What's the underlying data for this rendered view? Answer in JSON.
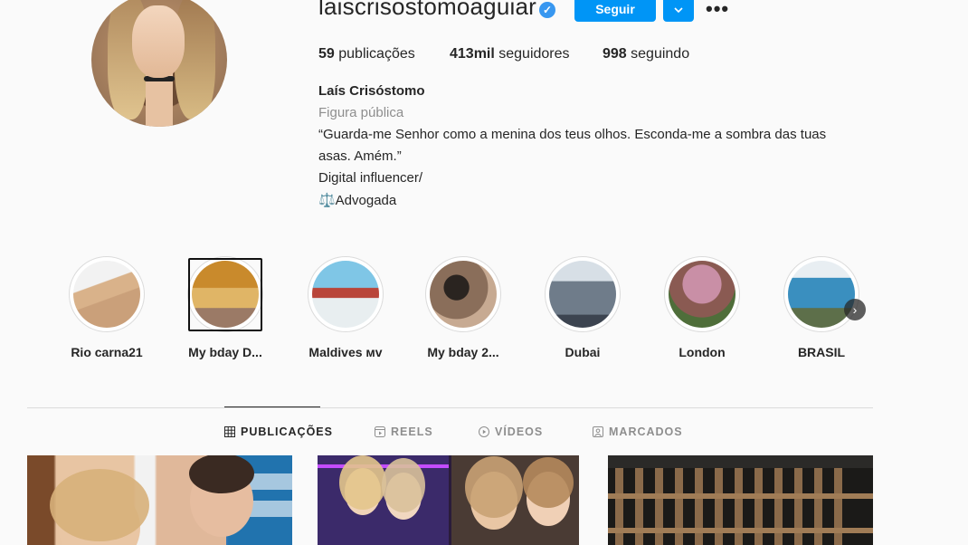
{
  "profile": {
    "username": "laiscrisostomoaguiar",
    "follow_label": "Seguir",
    "stats": {
      "posts_count": "59",
      "posts_label": " publicações",
      "followers_count": "413mil",
      "followers_label": " seguidores",
      "following_count": "998",
      "following_label": " seguindo"
    },
    "full_name": "Laís Crisóstomo",
    "category": "Figura pública",
    "bio_lines": [
      "“Guarda-me Senhor como a menina dos teus olhos. Esconda-me a sombra das tuas",
      "asas. Amém.”",
      "Digital influencer/",
      "⚖️Advogada"
    ]
  },
  "highlights": [
    {
      "label": "Rio carna21"
    },
    {
      "label": "My bday D..."
    },
    {
      "label": "Maldives ᴍᴠ"
    },
    {
      "label": "My bday 2..."
    },
    {
      "label": "Dubai"
    },
    {
      "label": "London"
    },
    {
      "label": "BRASIL"
    }
  ],
  "tabs": [
    {
      "label": "PUBLICAÇÕES",
      "icon": "grid-icon",
      "active": true
    },
    {
      "label": "REELS",
      "icon": "reels-icon",
      "active": false
    },
    {
      "label": "VÍDEOS",
      "icon": "play-icon",
      "active": false
    },
    {
      "label": "MARCADOS",
      "icon": "tagged-icon",
      "active": false
    }
  ],
  "colors": {
    "accent": "#0095f6",
    "verified": "#3897f0",
    "muted_text": "#8e8e8e",
    "background": "#fafafa"
  }
}
